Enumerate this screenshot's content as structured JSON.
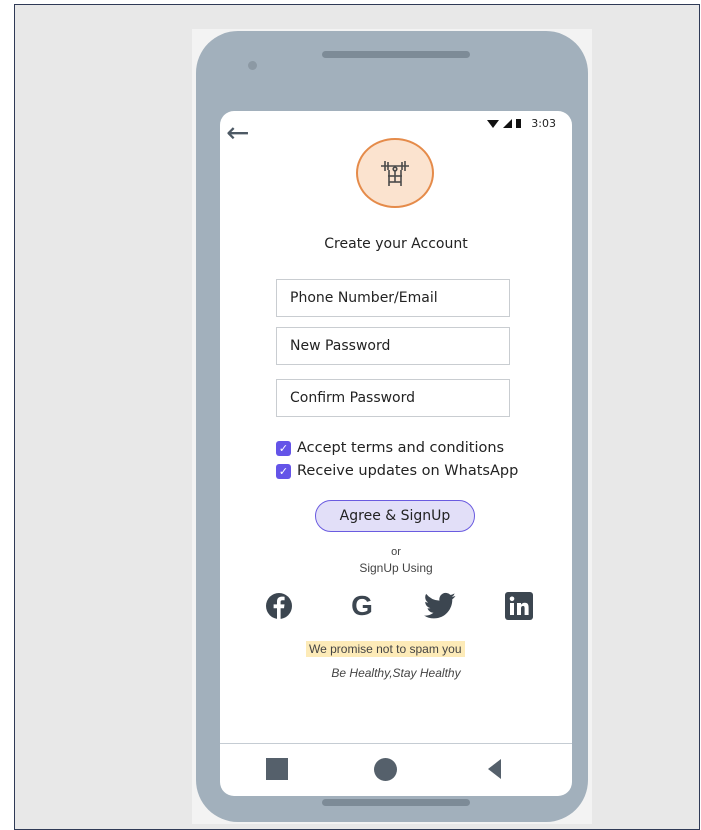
{
  "status_bar": {
    "time": "3:03"
  },
  "header": {
    "back_icon": "arrow-left-icon",
    "logo_icon": "gym-bench-icon"
  },
  "form": {
    "title": "Create your Account",
    "phone_email_placeholder": "Phone Number/Email",
    "new_password_placeholder": "New Password",
    "confirm_password_placeholder": "Confirm Password",
    "accept_terms_label": "Accept terms and conditions",
    "accept_terms_checked": true,
    "whatsapp_label": "Receive updates on WhatsApp",
    "whatsapp_checked": true,
    "signup_button_label": "Agree & SignUp"
  },
  "social": {
    "or_text": "or",
    "signup_using_text": "SignUp Using",
    "icons": [
      "facebook-icon",
      "google-icon",
      "twitter-icon",
      "linkedin-icon"
    ]
  },
  "footer": {
    "promise_text": "We promise not to spam you",
    "tagline": "Be Healthy,Stay Healthy"
  },
  "colors": {
    "accent": "#6454e8",
    "button_fill": "#e2dff8",
    "logo_fill": "#fbe3cf",
    "logo_border": "#e58b4a",
    "highlight": "#fdebb8",
    "phone_frame": "#a2b0bc"
  }
}
